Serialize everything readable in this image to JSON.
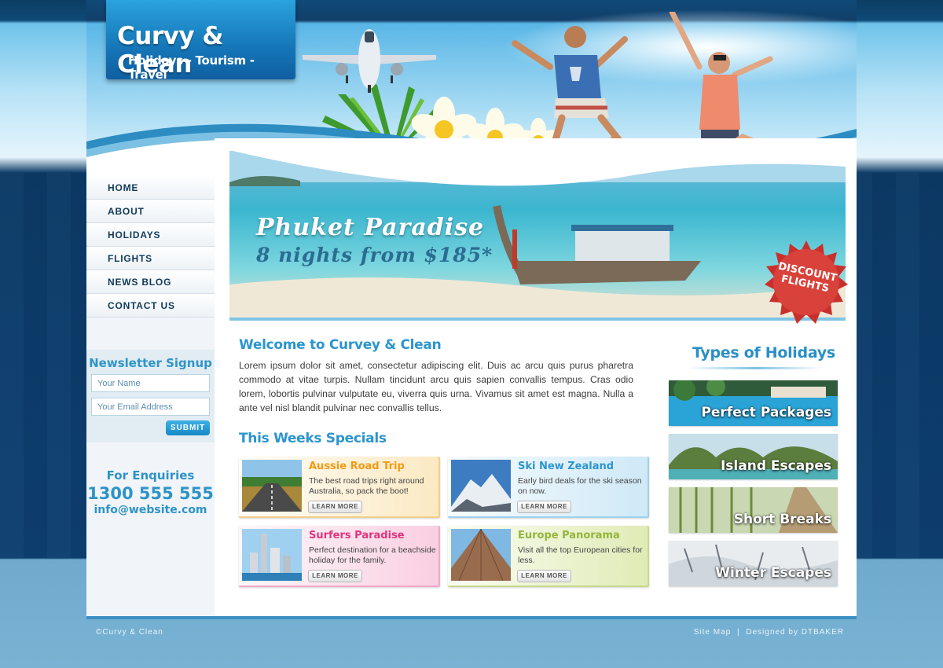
{
  "logo": {
    "title": "Curvy & Clean",
    "tagline": "Holidays - Tourism - Travel"
  },
  "nav": {
    "items": [
      {
        "label": "HOME"
      },
      {
        "label": "ABOUT"
      },
      {
        "label": "HOLIDAYS"
      },
      {
        "label": "FLIGHTS"
      },
      {
        "label": "NEWS BLOG"
      },
      {
        "label": "CONTACT US"
      }
    ]
  },
  "newsletter": {
    "title": "Newsletter Signup",
    "name_placeholder": "Your Name",
    "email_placeholder": "Your Email Address",
    "submit_label": "SUBMIT"
  },
  "enquiries": {
    "title": "For Enquiries",
    "phone": "1300 555 555",
    "email": "info@website.com"
  },
  "hero": {
    "title": "Phuket Paradise",
    "subtitle": "8 nights from $185*",
    "badge_line1": "DISCOUNT",
    "badge_line2": "FLIGHTS"
  },
  "welcome": {
    "title": "Welcome to Curvey & Clean",
    "body": "Lorem ipsum dolor sit amet, consectetur adipiscing elit. Duis ac arcu quis purus pharetra commodo at vitae turpis. Nullam tincidunt arcu quis sapien convallis tempus. Cras odio lorem, lobortis pulvinar vulputate eu, viverra quis urna. Vivamus sit amet est magna. Nulla a ante vel nisl blandit pulvinar nec convallis tellus."
  },
  "specials": {
    "title": "This Weeks Specials",
    "learn_more_label": "LEARN MORE",
    "items": [
      {
        "title": "Aussie Road Trip",
        "text": "The best road trips right around Australia, so pack the boot!",
        "accent": "#f39a12"
      },
      {
        "title": "Ski New Zealand",
        "text": "Early bird deals for the ski season on now.",
        "accent": "#2c95cf"
      },
      {
        "title": "Surfers Paradise",
        "text": "Perfect destination for a beachside holiday for the family.",
        "accent": "#e0357d"
      },
      {
        "title": "Europe Panorama",
        "text": "Visit all the top European cities for less.",
        "accent": "#93b53a"
      }
    ]
  },
  "holiday_types": {
    "title": "Types of Holidays",
    "items": [
      {
        "label": "Perfect Packages"
      },
      {
        "label": "Island Escapes"
      },
      {
        "label": "Short Breaks"
      },
      {
        "label": "Winter Escapes"
      }
    ]
  },
  "footer": {
    "copyright": "©Curvy & Clean",
    "sitemap": "Site Map",
    "separator": "|",
    "designed_by": "Designed by DTBAKER"
  }
}
